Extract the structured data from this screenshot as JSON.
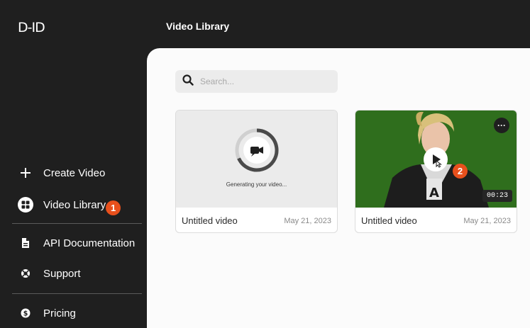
{
  "app": {
    "logo_text": "D-ID",
    "page_title": "Video Library"
  },
  "sidebar": {
    "items": [
      {
        "label": "Create Video",
        "icon": "plus-icon"
      },
      {
        "label": "Video Library",
        "icon": "grid-icon",
        "active": true,
        "badge": "1"
      },
      {
        "label": "API Documentation",
        "icon": "document-icon"
      },
      {
        "label": "Support",
        "icon": "lifebuoy-icon"
      },
      {
        "label": "Pricing",
        "icon": "dollar-icon"
      }
    ]
  },
  "search": {
    "placeholder": "Search..."
  },
  "videos": [
    {
      "name": "Untitled video",
      "date": "May 21, 2023",
      "status_text": "Generating your video...",
      "state": "generating"
    },
    {
      "name": "Untitled video",
      "date": "May 21, 2023",
      "duration": "00:23",
      "state": "ready",
      "badge": "2",
      "more_label": "···"
    }
  ],
  "colors": {
    "sidebar_bg": "#1f1f1f",
    "content_bg": "#fbfbfb",
    "accent_badge": "#e8501c",
    "thumb_green": "#2f6e1d"
  }
}
